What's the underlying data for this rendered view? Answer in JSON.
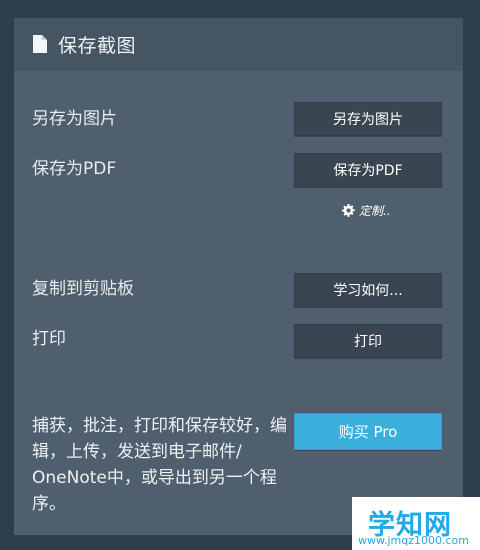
{
  "header": {
    "title": "保存截图",
    "icon": "document-icon"
  },
  "rows": {
    "save_image": {
      "label": "另存为图片",
      "button": "另存为图片"
    },
    "save_pdf": {
      "label": "保存为PDF",
      "button": "保存为PDF"
    },
    "customize": {
      "label": "定制..",
      "icon": "gear-icon"
    },
    "clipboard": {
      "label": "复制到剪贴板",
      "button": "学习如何..."
    },
    "print": {
      "label": "打印",
      "button": "打印"
    }
  },
  "promo": {
    "text": "捕获，批注，打印和保存较好，编辑，上传，发送到电子邮件/ OneNote中，或导出到另一个程序。",
    "button": "购买 Pro"
  },
  "watermark": {
    "big": "学知网",
    "small": "www.jmqz1000.com"
  },
  "colors": {
    "background": "#2e3e4d",
    "panel": "#4f5f6d",
    "header": "#465562",
    "button": "#3a4552",
    "accent": "#3aafdb"
  }
}
